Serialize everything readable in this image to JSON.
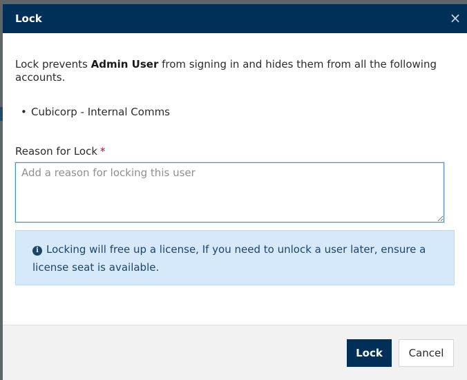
{
  "dialog": {
    "title": "Lock",
    "close_icon": "close-icon",
    "close_glyph": "×"
  },
  "body": {
    "intro_prefix": "Lock prevents ",
    "user_name": "Admin User",
    "intro_suffix": " from signing in and hides them from all the following accounts.",
    "accounts": [
      "Cubicorp - Internal Comms"
    ],
    "bullet_glyph": "•"
  },
  "reason_field": {
    "label": "Reason for Lock",
    "required_marker": "*",
    "value": "",
    "placeholder": "Add a reason for locking this user"
  },
  "info": {
    "icon": "info-icon",
    "icon_glyph": "i",
    "text": "Locking will free up a license, If you need to unlock a user later, ensure a license seat is available."
  },
  "footer": {
    "lock_label": "Lock",
    "cancel_label": "Cancel"
  },
  "colors": {
    "header_bg": "#003057",
    "primary_button": "#003057",
    "info_bg": "#d6e9fb",
    "required": "#d0021b"
  }
}
